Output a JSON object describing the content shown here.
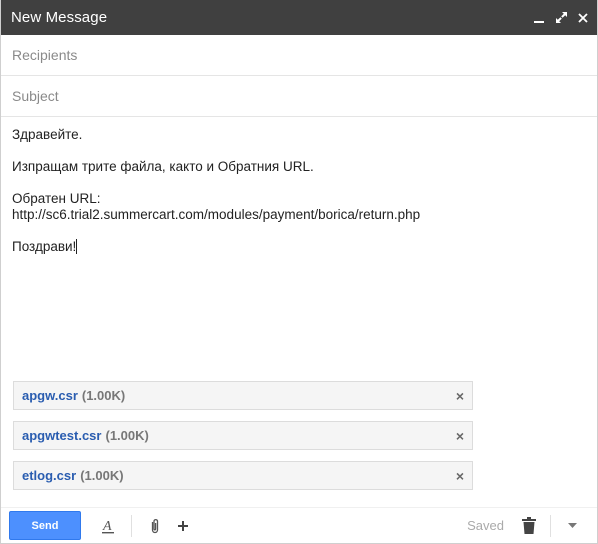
{
  "window": {
    "title": "New Message"
  },
  "fields": {
    "recipients_placeholder": "Recipients",
    "subject_placeholder": "Subject"
  },
  "body": {
    "line1": "Здравейте.",
    "line2": "Изпращам трите файла, както и Обратния URL.",
    "line3a": "Обратен URL:",
    "line3b": "http://sc6.trial2.summercart.com/modules/payment/borica/return.php",
    "line4": "Поздрави!"
  },
  "attachments": [
    {
      "name": "apgw.csr",
      "size": "(1.00K)"
    },
    {
      "name": "apgwtest.csr",
      "size": "(1.00K)"
    },
    {
      "name": "etlog.csr",
      "size": "(1.00K)"
    }
  ],
  "toolbar": {
    "send_label": "Send",
    "saved_label": "Saved"
  },
  "colors": {
    "titlebar": "#404040",
    "send_button": "#4d90fe",
    "attachment_link": "#2a5db0"
  },
  "icons": {
    "minimize": "minimize-icon",
    "popout": "popout-icon",
    "close": "close-icon",
    "formatting": "text-formatting-icon",
    "attach": "paperclip-icon",
    "more_options": "plus-icon",
    "discard": "trash-icon",
    "menu": "dropdown-arrow-icon"
  }
}
